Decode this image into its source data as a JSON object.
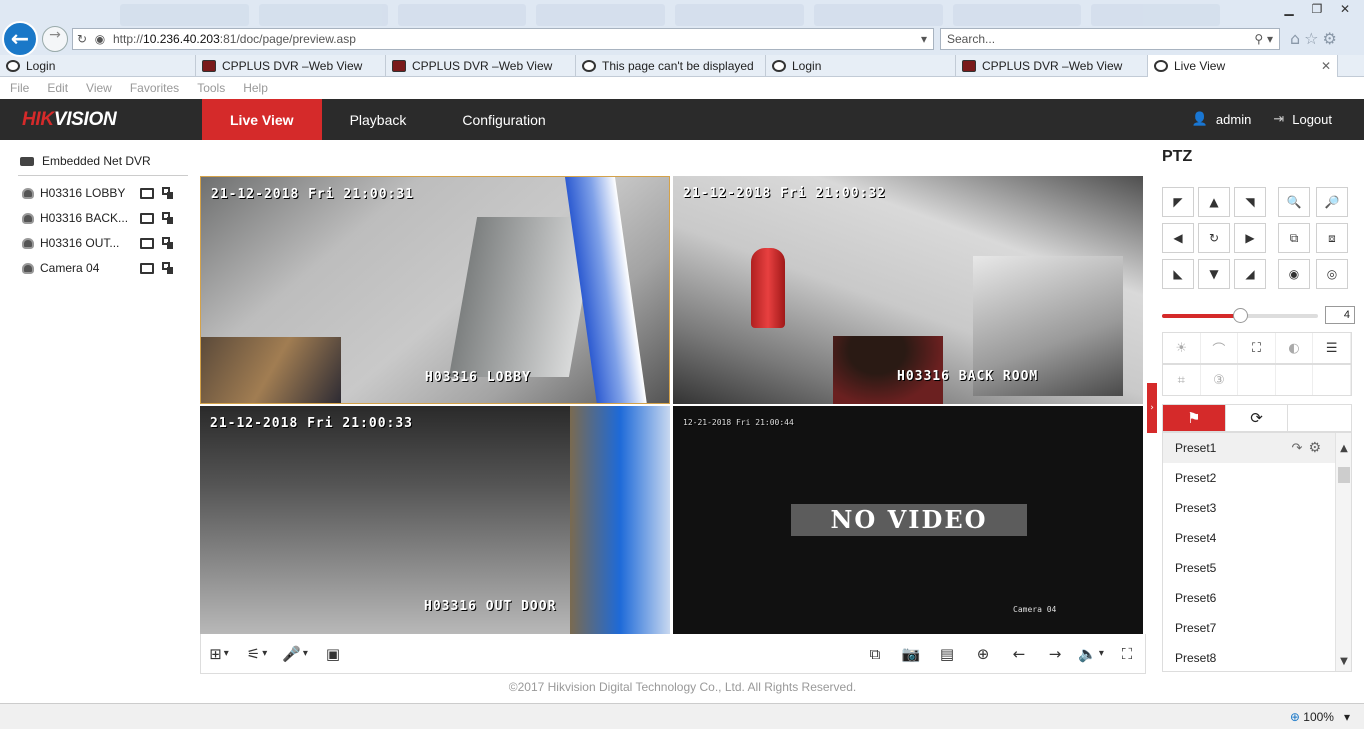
{
  "browser": {
    "address_url_prefix": "http://",
    "address_url_host": "10.236.40.203",
    "address_url_rest": ":81/doc/page/preview.asp",
    "search_placeholder": "Search...",
    "tabs": [
      {
        "label": "Login",
        "active": false
      },
      {
        "label": "CPPLUS DVR –Web View",
        "active": false
      },
      {
        "label": "CPPLUS DVR –Web View",
        "active": false
      },
      {
        "label": "This page can't be displayed",
        "active": false
      },
      {
        "label": "Login",
        "active": false
      },
      {
        "label": "CPPLUS DVR –Web View",
        "active": false
      },
      {
        "label": "Live View",
        "active": true
      }
    ],
    "menu": [
      "File",
      "Edit",
      "View",
      "Favorites",
      "Tools",
      "Help"
    ],
    "zoom": "100%"
  },
  "app": {
    "logo_red": "HIK",
    "logo_white": "VISION",
    "nav": [
      {
        "label": "Live View",
        "active": true
      },
      {
        "label": "Playback",
        "active": false
      },
      {
        "label": "Configuration",
        "active": false
      }
    ],
    "user": "admin",
    "logout": "Logout",
    "accent_color": "#d52a2a"
  },
  "device_tree": {
    "device": "Embedded Net DVR",
    "cameras": [
      "H03316 LOBBY",
      "H03316 BACK...",
      "H03316 OUT...",
      "Camera 04"
    ]
  },
  "video": {
    "tiles": [
      {
        "timestamp": "21-12-2018 Fri 21:00:31",
        "label": "H03316 LOBBY"
      },
      {
        "timestamp": "21-12-2018 Fri 21:00:32",
        "label": "H03316 BACK ROOM"
      },
      {
        "timestamp": "21-12-2018 Fri 21:00:33",
        "label": "H03316 OUT DOOR"
      },
      {
        "timestamp": "12-21-2018 Fri 21:00:44",
        "label": "Camera 04",
        "status": "NO VIDEO"
      }
    ]
  },
  "footer": {
    "copyright": "©2017 Hikvision Digital Technology Co., Ltd. All Rights Reserved."
  },
  "ptz": {
    "title": "PTZ",
    "speed": "4",
    "speed_fraction": 0.5,
    "presets": [
      "Preset1",
      "Preset2",
      "Preset3",
      "Preset4",
      "Preset5",
      "Preset6",
      "Preset7",
      "Preset8"
    ]
  }
}
